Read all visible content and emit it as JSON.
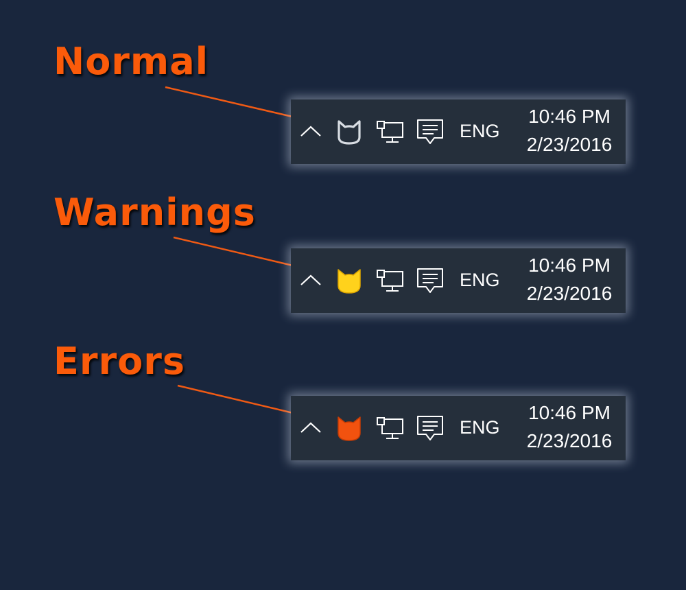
{
  "colors": {
    "background": "#19263d",
    "heading": "#fb5b0a",
    "arrow": "#f05a14",
    "tray_background": "#252f3b",
    "tray_text": "#ffffff",
    "cat_normal_outline": "#d8dde3",
    "cat_warning": "#ffd21c",
    "cat_error": "#f2520f"
  },
  "sections": [
    {
      "heading": "Normal",
      "state": "normal",
      "tray": {
        "chevron_icon": "chevron-up-icon",
        "status_icon": "cat-icon-outline",
        "network_icon": "network-icon",
        "notifications_icon": "action-center-icon",
        "language": "ENG",
        "time": "10:46 PM",
        "date": "2/23/2016"
      }
    },
    {
      "heading": "Warnings",
      "state": "warning",
      "tray": {
        "chevron_icon": "chevron-up-icon",
        "status_icon": "cat-icon-yellow",
        "network_icon": "network-icon",
        "notifications_icon": "action-center-icon",
        "language": "ENG",
        "time": "10:46 PM",
        "date": "2/23/2016"
      }
    },
    {
      "heading": "Errors",
      "state": "error",
      "tray": {
        "chevron_icon": "chevron-up-icon",
        "status_icon": "cat-icon-orange",
        "network_icon": "network-icon",
        "notifications_icon": "action-center-icon",
        "language": "ENG",
        "time": "10:46 PM",
        "date": "2/23/2016"
      }
    }
  ]
}
